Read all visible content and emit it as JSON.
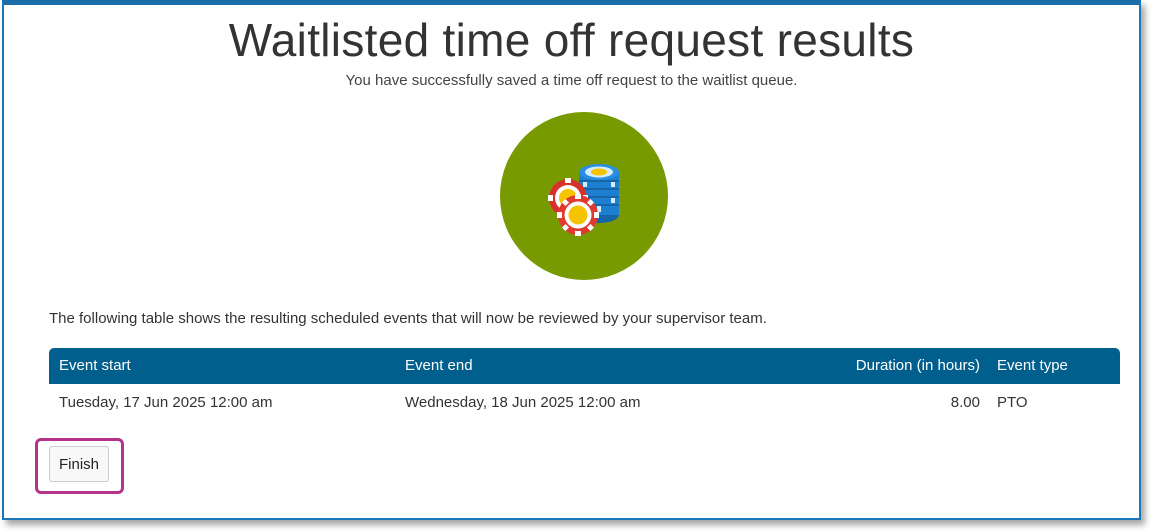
{
  "page": {
    "title": "Waitlisted time off request results",
    "subtitle": "You have successfully saved a time off request to the waitlist queue."
  },
  "illustration": {
    "icon": "poker-chips-icon",
    "circle_color": "#779a00"
  },
  "intro_text": "The following table shows the resulting scheduled events that will now be reviewed by your supervisor team.",
  "table": {
    "header_color": "#005f8c",
    "columns": [
      "Event start",
      "Event end",
      "Duration (in hours)",
      "Event type"
    ],
    "rows": [
      [
        "Tuesday, 17 Jun 2025 12:00 am",
        "Wednesday, 18 Jun 2025 12:00 am",
        "8.00",
        "PTO"
      ]
    ]
  },
  "actions": {
    "finish_label": "Finish",
    "highlight_color": "#b5338a"
  }
}
